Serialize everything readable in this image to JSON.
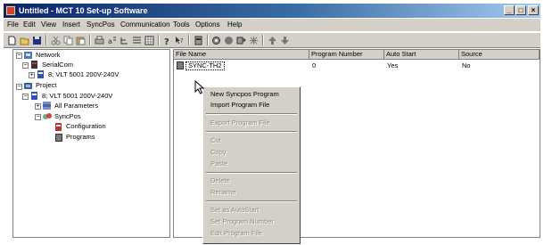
{
  "window": {
    "title": "Untitled - MCT 10 Set-up Software",
    "controls": [
      "_",
      "□",
      "×"
    ]
  },
  "menubar": {
    "items": [
      "File",
      "Edit",
      "View",
      "Insert",
      "SyncPos",
      "Communication",
      "Tools",
      "Options",
      "Help"
    ]
  },
  "tree": {
    "network": "Network",
    "serialcom": "SerialCom",
    "serial_drive": "8; VLT 5001 200V-240V",
    "project": "Project",
    "project_drive": "8; VLT 5001 200V-240V",
    "all_parameters": "All Parameters",
    "syncpos": "SyncPos",
    "configuration": "Configuration",
    "programs": "Programs"
  },
  "list": {
    "columns": [
      "File Name",
      "Program Number",
      "Auto Start",
      "Source"
    ],
    "rows": [
      {
        "file_name": "SYNC-TH2",
        "program_number": "0",
        "auto_start": "Yes",
        "source": "No"
      }
    ]
  },
  "context_menu": {
    "new_syncpos_program": "New Syncpos Program",
    "import_program_file": "Import Program File",
    "export_program_file": "Export Program File",
    "cut": "Cut",
    "copy": "Copy",
    "paste": "Paste",
    "delete": "Delete",
    "rename": "Rename",
    "set_as_autostart": "Set as AutoStart",
    "set_program_number": "Set Program Number",
    "edit_program_file": "Edit Program File"
  }
}
